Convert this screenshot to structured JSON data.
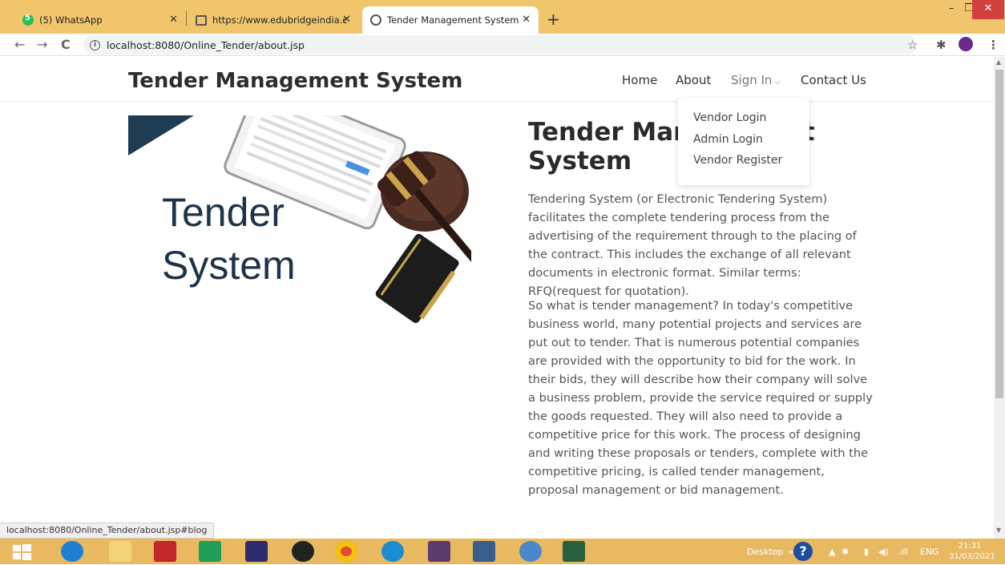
{
  "browser": {
    "tabs": [
      {
        "title": "(5) WhatsApp",
        "icon": "whatsapp-icon"
      },
      {
        "title": "https://www.edubridgeindia.com",
        "icon": "edubridge-icon"
      },
      {
        "title": "Tender Management System",
        "icon": "globe-icon",
        "active": true
      }
    ],
    "url": "localhost:8080/Online_Tender/about.jsp",
    "status_url": "localhost:8080/Online_Tender/about.jsp#blog"
  },
  "site": {
    "brand": "Tender Management System",
    "nav": {
      "home": "Home",
      "about": "About",
      "signin": "Sign In",
      "contact": "Contact Us"
    },
    "dropdown": [
      "Vendor Login",
      "Admin Login",
      "Vendor Register"
    ]
  },
  "hero": {
    "line1": "Tender",
    "line2": "System"
  },
  "content": {
    "title": "Tender Management System",
    "para1": "Tendering System (or Electronic Tendering System) facilitates the complete tendering process from the advertising of the requirement through to the placing of the contract. This includes the exchange of all relevant documents in electronic format. Similar terms: RFQ(request for quotation).",
    "para2": "So what is tender management? In today's competitive business world, many potential projects and services are put out to tender. That is numerous potential companies are provided with the opportunity to bid for the work. In their bids, they will describe how their company will solve a business problem, provide the service required or supply the goods requested. They will also need to provide a competitive price for this work. The process of designing and writing these proposals or tenders, complete with the competitive pricing, is called tender management, proposal management or bid management."
  },
  "taskbar": {
    "desktop_label": "Desktop",
    "lang": "ENG",
    "time": "21:31",
    "date": "31/03/2021"
  },
  "colors": {
    "tabbar": "#f0c56b",
    "taskbar": "#e9b962",
    "hero_text": "#1e3348"
  }
}
